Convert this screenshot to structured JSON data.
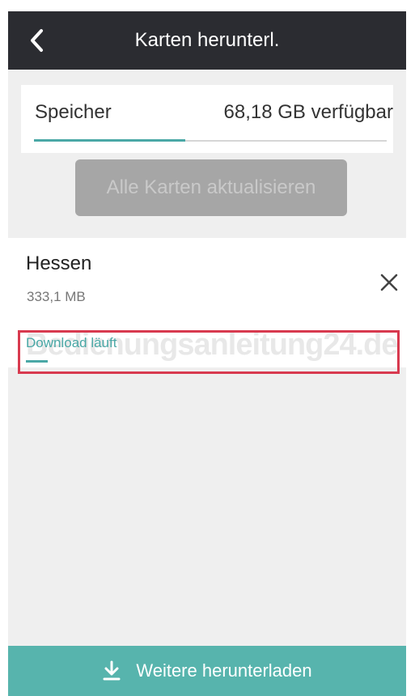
{
  "header": {
    "title": "Karten herunterl.",
    "back_icon": "chevron-left-icon"
  },
  "storage": {
    "label": "Speicher",
    "value": "68,18 GB verfügbar",
    "used_fraction": 0.43,
    "accent": "#4aa8a6"
  },
  "update_all_button": {
    "label": "Alle Karten aktualisieren"
  },
  "download_item": {
    "name": "Hessen",
    "size": "333,1 MB",
    "status": "Download läuft",
    "progress_fraction": 0.06,
    "cancel_icon": "close-icon"
  },
  "watermark": "Bedienungsanleitung24.de",
  "bottom_bar": {
    "label": "Weitere herunterladen",
    "icon": "download-icon",
    "color": "#57b4ad"
  },
  "colors": {
    "header_bg": "#2b2c31",
    "highlight_border": "#d83a4f"
  }
}
